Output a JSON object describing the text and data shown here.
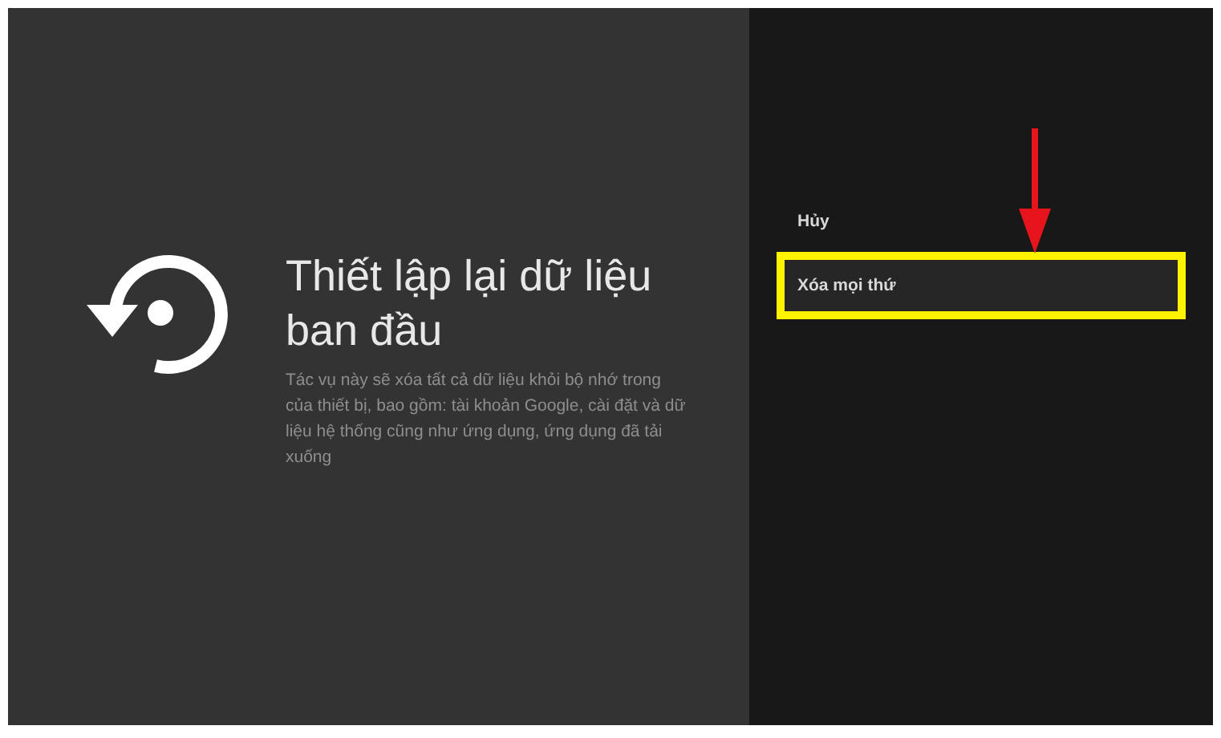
{
  "dialog": {
    "title": "Thiết lập lại dữ liệu ban đầu",
    "description": "Tác vụ này sẽ xóa tất cả dữ liệu khỏi bộ nhớ trong của thiết bị, bao gồm: tài khoản Google, cài đặt và dữ liệu hệ thống cũng như ứng dụng, ứng dụng đã tải xuống"
  },
  "options": [
    {
      "label": "Hủy",
      "selected": false
    },
    {
      "label": "Xóa mọi thứ",
      "selected": true
    }
  ]
}
